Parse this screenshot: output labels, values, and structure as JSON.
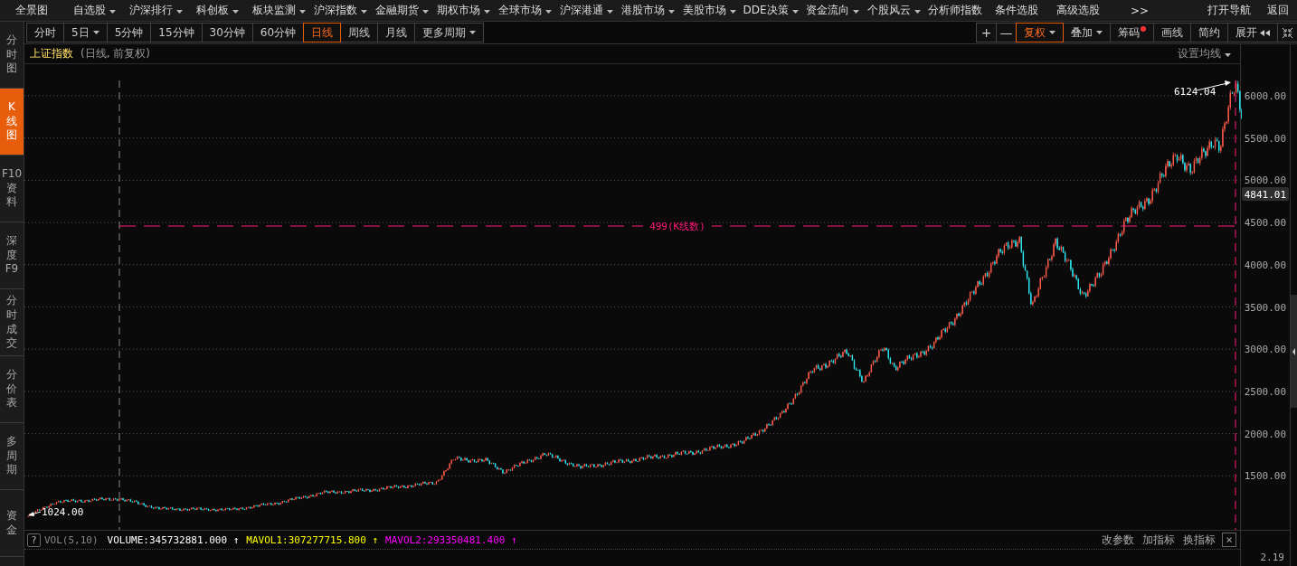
{
  "menu": [
    {
      "label": "全景图",
      "dropdown": false
    },
    {
      "label": "自选股",
      "dropdown": true
    },
    {
      "label": "沪深排行",
      "dropdown": true
    },
    {
      "label": "科创板",
      "dropdown": true
    },
    {
      "label": "板块监测",
      "dropdown": true
    },
    {
      "label": "沪深指数",
      "dropdown": true
    },
    {
      "label": "金融期货",
      "dropdown": true
    },
    {
      "label": "期权市场",
      "dropdown": true
    },
    {
      "label": "全球市场",
      "dropdown": true
    },
    {
      "label": "沪深港通",
      "dropdown": true
    },
    {
      "label": "港股市场",
      "dropdown": true
    },
    {
      "label": "美股市场",
      "dropdown": true
    },
    {
      "label": "DDE决策",
      "dropdown": true
    },
    {
      "label": "资金流向",
      "dropdown": true
    },
    {
      "label": "个股风云",
      "dropdown": true
    },
    {
      "label": "分析师指数",
      "dropdown": false
    },
    {
      "label": "条件选股",
      "dropdown": false
    },
    {
      "label": "高级选股",
      "dropdown": false
    },
    {
      "label": ">>",
      "dropdown": false
    }
  ],
  "menu_right": [
    "打开导航",
    "返回"
  ],
  "sidebar": [
    {
      "label": "分时图",
      "selected": false
    },
    {
      "label": "K线图",
      "selected": true
    },
    {
      "label": "F10资料",
      "selected": false
    },
    {
      "label": "深度F9",
      "selected": false
    },
    {
      "label": "分时成交",
      "selected": false
    },
    {
      "label": "分价表",
      "selected": false
    },
    {
      "label": "多周期",
      "selected": false
    },
    {
      "label": "资金",
      "selected": false
    }
  ],
  "periods": [
    {
      "label": "分时",
      "selected": false,
      "dropdown": false
    },
    {
      "label": "5日",
      "selected": false,
      "dropdown": true
    },
    {
      "label": "5分钟",
      "selected": false,
      "dropdown": false
    },
    {
      "label": "15分钟",
      "selected": false,
      "dropdown": false
    },
    {
      "label": "30分钟",
      "selected": false,
      "dropdown": false
    },
    {
      "label": "60分钟",
      "selected": false,
      "dropdown": false
    },
    {
      "label": "日线",
      "selected": true,
      "dropdown": false
    },
    {
      "label": "周线",
      "selected": false,
      "dropdown": false
    },
    {
      "label": "月线",
      "selected": false,
      "dropdown": false
    },
    {
      "label": "更多周期",
      "selected": false,
      "dropdown": true
    }
  ],
  "tools": [
    {
      "kind": "icon",
      "label": "+",
      "selected": false,
      "dropdown": false,
      "dot": false
    },
    {
      "kind": "icon",
      "label": "—",
      "selected": false,
      "dropdown": false,
      "dot": false
    },
    {
      "kind": "text",
      "label": "复权",
      "selected": true,
      "dropdown": true,
      "dot": false
    },
    {
      "kind": "text",
      "label": "叠加",
      "selected": false,
      "dropdown": true,
      "dot": false
    },
    {
      "kind": "text",
      "label": "筹码",
      "selected": false,
      "dropdown": false,
      "dot": true
    },
    {
      "kind": "text",
      "label": "画线",
      "selected": false,
      "dropdown": false,
      "dot": false
    },
    {
      "kind": "text",
      "label": "简约",
      "selected": false,
      "dropdown": false,
      "dot": false
    },
    {
      "kind": "expand",
      "label": "展开",
      "selected": false,
      "dropdown": false,
      "dot": false
    },
    {
      "kind": "collapse",
      "selected": false,
      "dropdown": false,
      "dot": false
    }
  ],
  "chart": {
    "title": "上证指数",
    "subtitle": "(日线, 前复权)",
    "ma_setting": "设置均线",
    "y_ticks": [
      "6000.00",
      "5500.00",
      "5000.00",
      "4500.00",
      "4000.00",
      "3500.00",
      "3000.00",
      "2500.00",
      "2000.00",
      "1500.00"
    ],
    "current_price": "4841.01",
    "high_label": "6124.04",
    "low_label": "1024.00",
    "range_label": "499(K线数)"
  },
  "volume": {
    "help": "?",
    "name": "VOL(5,10)",
    "items": [
      {
        "label": "VOLUME:345732881.000",
        "arrow": "↑",
        "color": "#ffffff"
      },
      {
        "label": "MAVOL1:307277715.800",
        "arrow": "↑",
        "color": "#ffff00"
      },
      {
        "label": "MAVOL2:293350481.400",
        "arrow": "↑",
        "color": "#ff00ff"
      }
    ],
    "buttons": [
      "改参数",
      "加指标",
      "换指标"
    ],
    "close": "×",
    "axis_value": "2.19"
  }
}
